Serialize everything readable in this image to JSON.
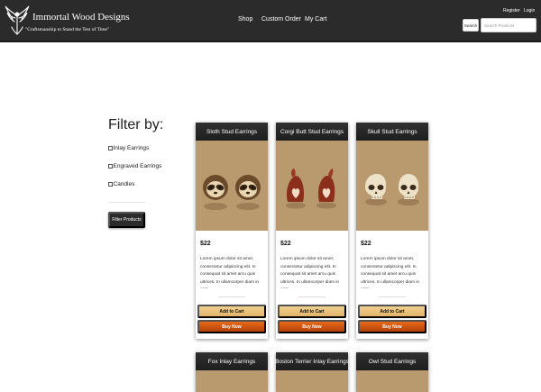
{
  "header": {
    "brand": "Immortal Wood Designs",
    "tagline": "\"Craftsmanship to Stand the Test of Time\"",
    "nav": [
      "Shop",
      "Custom Order",
      "My Cart"
    ],
    "account": {
      "register": "Register",
      "login": "Login"
    },
    "search": {
      "button": "Search",
      "placeholder": "Search Products",
      "value": ""
    }
  },
  "filters": {
    "heading": "Filter by:",
    "options": [
      "Inlay Earrings",
      "Engraved Earrings",
      "Candles"
    ],
    "button": "Filter Products"
  },
  "products": [
    {
      "title": "Sloth Stud Earrings",
      "price": "$22",
      "description": "Lorem ipsum dolor sit amet, consectetur adipiscing elit. In consequat sit amet arcu quis ultrices. In ullamcorper diam in ante",
      "add_label": "Add to Cart",
      "buy_label": "Buy Now",
      "image_icon": "sloth-earrings-image"
    },
    {
      "title": "Corgi Butt Stud Earrings",
      "price": "$22",
      "description": "Lorem ipsum dolor sit amet, consectetur adipiscing elit. In consequat sit amet arcu quis ultrices. In ullamcorper diam in ante",
      "add_label": "Add to Cart",
      "buy_label": "Buy Now",
      "image_icon": "corgi-earrings-image"
    },
    {
      "title": "Skull Stud Earrings",
      "price": "$22",
      "description": "Lorem ipsum dolor sit amet, consectetur adipiscing elit. In consequat sit amet arcu quis ultrices. In ullamcorper diam in ante",
      "add_label": "Add to Cart",
      "buy_label": "Buy Now",
      "image_icon": "skull-earrings-image"
    },
    {
      "title": "Fox Inlay Earrings"
    },
    {
      "title": "Boston Terrier Inlay Earrings"
    },
    {
      "title": "Owl Stud Earrings"
    }
  ],
  "colors": {
    "navbar": "#2b2b2b",
    "add_to_cart": "#e8c07a",
    "buy_now": "#d4560f",
    "product_background": "#b89a6e"
  }
}
